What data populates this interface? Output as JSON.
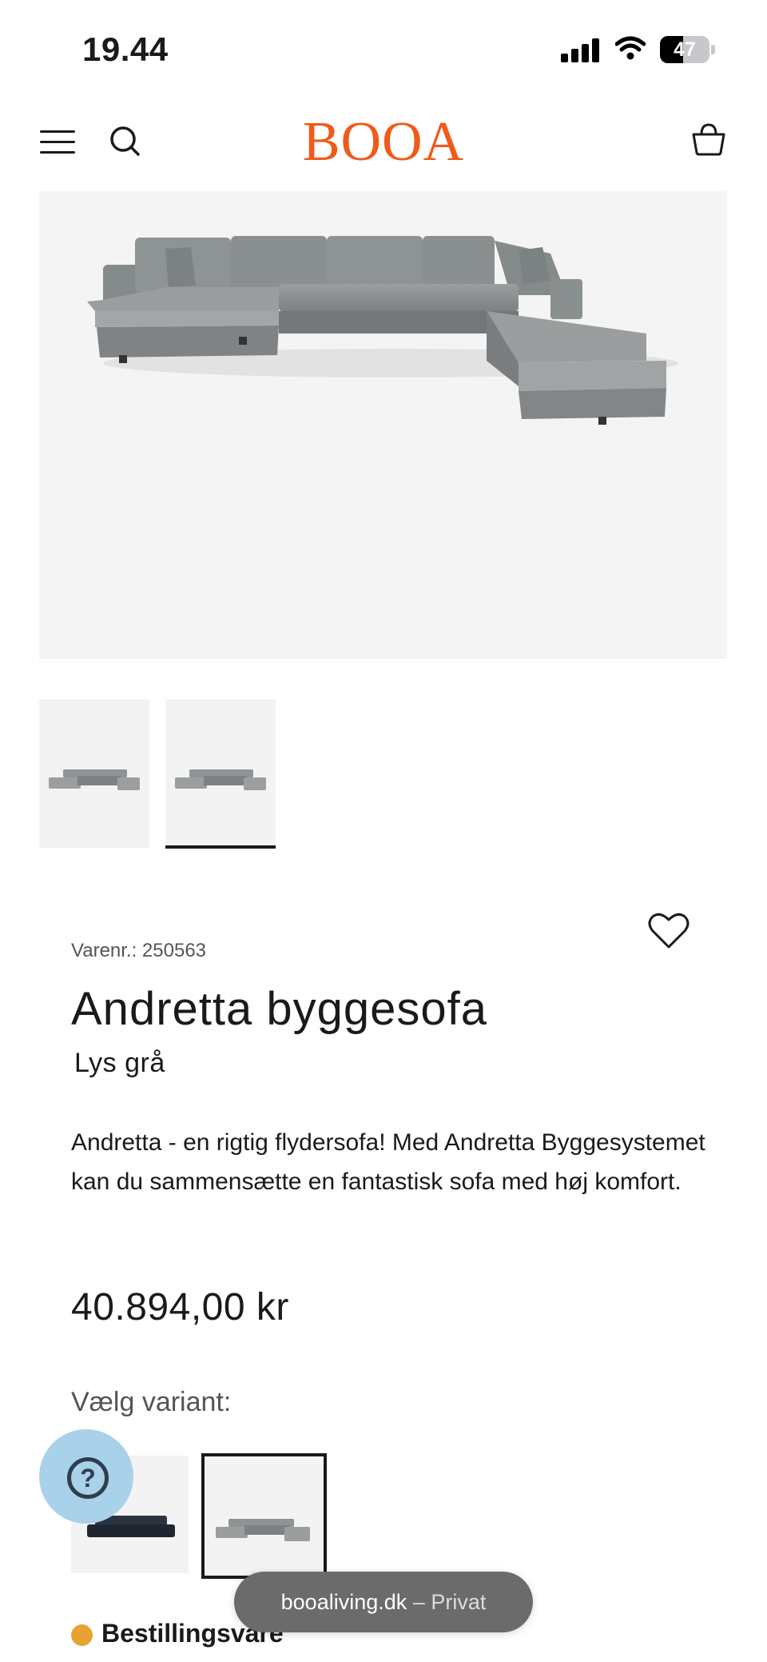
{
  "status_bar": {
    "time": "19.44",
    "battery": "47",
    "battery_level": 0.47
  },
  "header": {
    "logo": "BOOA",
    "icons": [
      "menu-icon",
      "search-icon",
      "cart-icon"
    ]
  },
  "gallery": {
    "thumbnails": 2,
    "selected_index": 1
  },
  "product": {
    "sku": "Varenr.: 250563",
    "title": "Andretta byggesofa",
    "subtitle": "Lys grå",
    "description": "Andretta - en rigtig flydersofa! Med Andretta Byggesystemet kan du sammensætte en fantastisk sofa med høj komfort.",
    "price": "40.894,00 kr",
    "variant_label": "Vælg variant:",
    "selected_variant_index": 1,
    "availability": "Bestillingsvare",
    "availability_color": "#e8a233"
  },
  "browser": {
    "domain": "booaliving.dk",
    "separator": "–",
    "mode": "Privat"
  },
  "colors": {
    "brand": "#ef5a1a",
    "help_button": "#a9d1ea",
    "sofa_grey": "#8c9090",
    "sofa_dark": "#1f2630"
  }
}
